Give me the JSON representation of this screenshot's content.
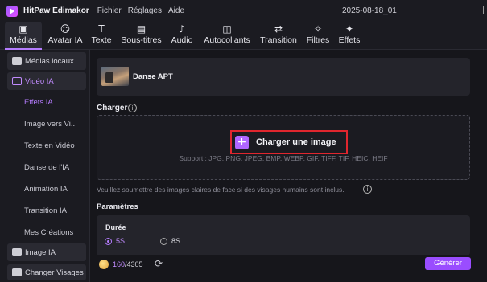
{
  "titlebar": {
    "app_name": "HitPaw Edimakor",
    "menus": [
      "Fichier",
      "Réglages",
      "Aide"
    ],
    "project_title": "2025-08-18_01"
  },
  "toolbar": {
    "items": [
      {
        "label": "Médias",
        "icon": "media-icon",
        "glyph": "▣"
      },
      {
        "label": "Avatar IA",
        "icon": "avatar-icon",
        "glyph": "☺"
      },
      {
        "label": "Texte",
        "icon": "text-icon",
        "glyph": "T"
      },
      {
        "label": "Sous-titres",
        "icon": "subtitles-icon",
        "glyph": "▤"
      },
      {
        "label": "Audio",
        "icon": "music-note-icon",
        "glyph": "♪"
      },
      {
        "label": "Autocollants",
        "icon": "sticker-icon",
        "glyph": "◫"
      },
      {
        "label": "Transition",
        "icon": "transition-icon",
        "glyph": "⇄"
      },
      {
        "label": "Filtres",
        "icon": "filter-icon",
        "glyph": "✧"
      },
      {
        "label": "Effets",
        "icon": "effects-icon",
        "glyph": "✦"
      }
    ],
    "active": "Médias"
  },
  "sidebar": {
    "items": [
      {
        "label": "Médias locaux",
        "type": "category",
        "icon": "folder-icon"
      },
      {
        "label": "Vidéo IA",
        "type": "category",
        "icon": "ai-video-icon",
        "selected": true
      },
      {
        "label": "Effets IA",
        "type": "sub",
        "selected": true
      },
      {
        "label": "Image vers Vi...",
        "type": "sub"
      },
      {
        "label": "Texte en Vidéo",
        "type": "sub"
      },
      {
        "label": "Danse de l'IA",
        "type": "sub"
      },
      {
        "label": "Animation IA",
        "type": "sub"
      },
      {
        "label": "Transition IA",
        "type": "sub"
      },
      {
        "label": "Mes Créations",
        "type": "sub"
      },
      {
        "label": "Image IA",
        "type": "category",
        "icon": "image-icon"
      },
      {
        "label": "Changer Visages",
        "type": "category",
        "icon": "face-swap-icon"
      }
    ]
  },
  "main": {
    "media_title": "Danse APT",
    "upload_section_label": "Charger",
    "upload_button_label": "Charger une image",
    "support_text": "Support : JPG, PNG, JPEG, BMP, WEBP, GIF, TIFF, TIF, HEIC, HEIF",
    "notice": "Veuillez soumettre des images claires de face si des visages humains sont inclus.",
    "params_label": "Paramètres",
    "duration_label": "Durée",
    "duration_options": [
      "5S",
      "8S"
    ],
    "duration_selected": "5S"
  },
  "bottom": {
    "credits_used": "160",
    "credits_total": "/4305",
    "generate_label": "Générer"
  },
  "colors": {
    "accent": "#9a4dff",
    "highlight_box": "#e0262e"
  }
}
